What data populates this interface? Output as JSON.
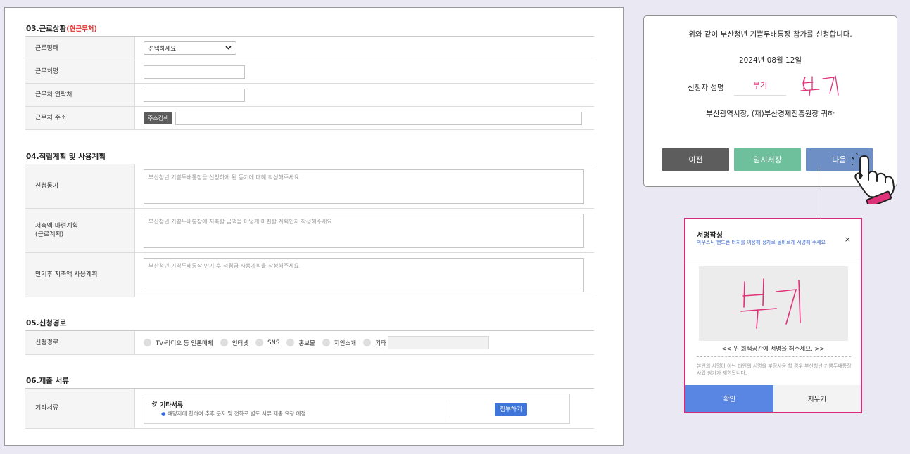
{
  "sections": {
    "work": {
      "title": "03.근로상황",
      "title_note": "(현근무처)",
      "rows": {
        "type_label": "근로형태",
        "type_select": "선택하세요",
        "name_label": "근무처명",
        "contact_label": "근무처 연락처",
        "address_label": "근무처 주소",
        "address_button": "주소검색"
      }
    },
    "plan": {
      "title": "04.적립계획 및 사용계획",
      "rows": {
        "motive_label": "신청동기",
        "motive_placeholder": "부산청년 기쁨두배통장을 신청하게 된 동기에 대해 작성해주세요",
        "saving_label_1": "저축액 마련계획",
        "saving_label_2": "(근로계획)",
        "saving_placeholder": "부산청년 기쁨두배통장에 저축할 금액을 어떻게 마련할 계획인지 작성해주세요",
        "use_label": "만기후 저축액 사용계획",
        "use_placeholder": "부산청년 기쁨두배통장 만기 후 적립금 사용계획을 작성해주세요"
      }
    },
    "route": {
      "title": "05.신청경로",
      "label": "신청경로",
      "options": [
        "TV·라디오 등 언론매체",
        "인터넷",
        "SNS",
        "홍보물",
        "지인소개",
        "기타"
      ]
    },
    "docs": {
      "title": "06.제출 서류",
      "label": "기타서류",
      "file_title": "기타서류",
      "file_note": "해당자에 한하여 추후 문자 및 전화로 별도 서류 제출 요청 예정",
      "attach_button": "첨부하기"
    }
  },
  "confirm": {
    "statement": "위와 같이 부산청년 기쁨두배통장 참가를 신청합니다.",
    "date": "2024년 08월 12일",
    "applicant_label": "신청자 성명",
    "applicant_name": "부기",
    "recipient": "부산광역시장, (재)부산경제진흥원장 귀하",
    "prev_button": "이전",
    "save_button": "임시저장",
    "next_button": "다음"
  },
  "signature_modal": {
    "title": "서명작성",
    "subtitle": "마우스나 핸드폰 터치를 이용해 정자로 올바르게 서명해 주세요",
    "close": "×",
    "hint": "<< 위 회색공간에 서명을 해주세요. >>",
    "warning": "본인의 서명이 아닌 타인의 서명을 부정사용 할 경우 부산청년 기쁨두배통장 사업 참가가 제한됩니다.",
    "confirm_button": "확인",
    "clear_button": "지우기"
  },
  "colors": {
    "accent_blue": "#3f74d8",
    "prev": "#5d5d5d",
    "save": "#6ebf9b",
    "next": "#6d8fc5",
    "modal_border": "#d62a7a",
    "signature_ink": "#e0327a"
  }
}
